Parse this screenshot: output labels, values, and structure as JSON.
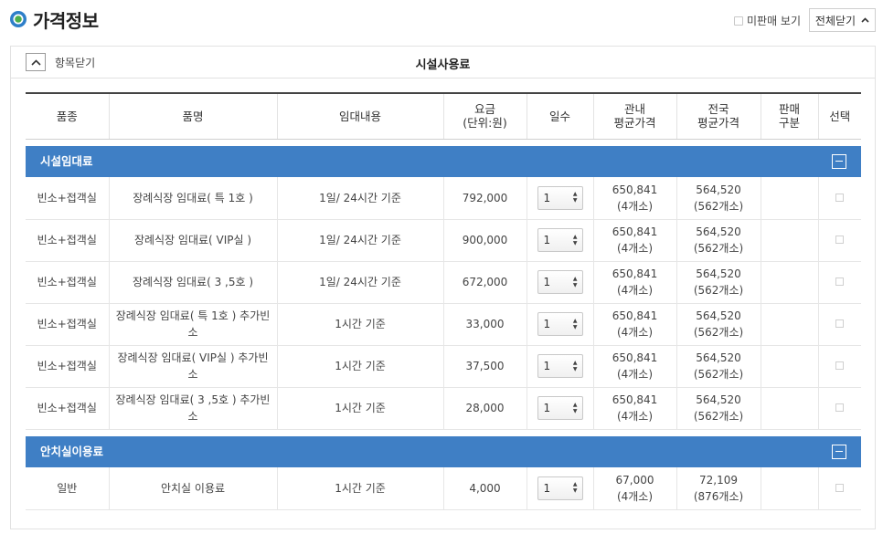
{
  "header": {
    "title": "가격정보",
    "hide_unsold_label": "미판매 보기",
    "collapse_all_label": "전체닫기"
  },
  "panel": {
    "toggle_label": "항목닫기",
    "title": "시설사용료"
  },
  "table": {
    "headers": {
      "category": "품종",
      "item": "품명",
      "rental": "임대내용",
      "fee_line1": "요금",
      "fee_line2": "(단위:원)",
      "days": "일수",
      "local_line1": "관내",
      "local_line2": "평균가격",
      "national_line1": "전국",
      "national_line2": "평균가격",
      "sale_line1": "판매",
      "sale_line2": "구분",
      "select": "선택"
    },
    "sections": [
      {
        "name": "시설임대료",
        "rows": [
          {
            "category": "빈소+접객실",
            "item": "장례식장 임대료( 특 1호 )",
            "rental": "1일/ 24시간 기준",
            "fee": "792,000",
            "days": "1",
            "local_avg": "650,841",
            "local_count": "(4개소)",
            "national_avg": "564,520",
            "national_count": "(562개소)",
            "sale_type": ""
          },
          {
            "category": "빈소+접객실",
            "item": "장례식장 임대료( VIP실 )",
            "rental": "1일/ 24시간 기준",
            "fee": "900,000",
            "days": "1",
            "local_avg": "650,841",
            "local_count": "(4개소)",
            "national_avg": "564,520",
            "national_count": "(562개소)",
            "sale_type": ""
          },
          {
            "category": "빈소+접객실",
            "item": "장례식장 임대료( 3 ,5호 )",
            "rental": "1일/ 24시간 기준",
            "fee": "672,000",
            "days": "1",
            "local_avg": "650,841",
            "local_count": "(4개소)",
            "national_avg": "564,520",
            "national_count": "(562개소)",
            "sale_type": ""
          },
          {
            "category": "빈소+접객실",
            "item": "장례식장 임대료( 특 1호 ) 추가빈소",
            "rental": "1시간 기준",
            "fee": "33,000",
            "days": "1",
            "local_avg": "650,841",
            "local_count": "(4개소)",
            "national_avg": "564,520",
            "national_count": "(562개소)",
            "sale_type": ""
          },
          {
            "category": "빈소+접객실",
            "item": "장례식장 임대료( VIP실 ) 추가빈소",
            "rental": "1시간 기준",
            "fee": "37,500",
            "days": "1",
            "local_avg": "650,841",
            "local_count": "(4개소)",
            "national_avg": "564,520",
            "national_count": "(562개소)",
            "sale_type": ""
          },
          {
            "category": "빈소+접객실",
            "item": "장례식장 임대료( 3 ,5호 ) 추가빈소",
            "rental": "1시간 기준",
            "fee": "28,000",
            "days": "1",
            "local_avg": "650,841",
            "local_count": "(4개소)",
            "national_avg": "564,520",
            "national_count": "(562개소)",
            "sale_type": ""
          }
        ]
      },
      {
        "name": "안치실이용료",
        "rows": [
          {
            "category": "일반",
            "item": "안치실 이용료",
            "rental": "1시간 기준",
            "fee": "4,000",
            "days": "1",
            "local_avg": "67,000",
            "local_count": "(4개소)",
            "national_avg": "72,109",
            "national_count": "(876개소)",
            "sale_type": ""
          }
        ]
      }
    ]
  },
  "colors": {
    "section_bar": "#3f7fc5",
    "logo_outer": "#2e7fc9",
    "logo_inner": "#4cae4c"
  },
  "icons": [
    "logo-icon",
    "chevron-up-icon",
    "collapse-section-icon",
    "spinner-icon"
  ]
}
